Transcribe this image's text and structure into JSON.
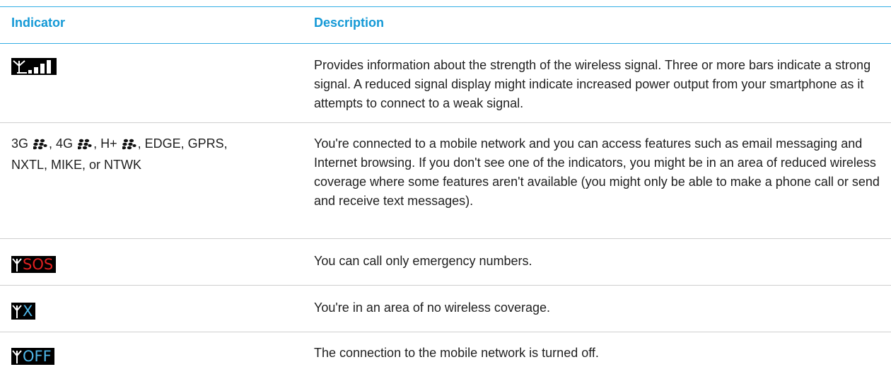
{
  "header": {
    "indicator": "Indicator",
    "description": "Description"
  },
  "rows": [
    {
      "indicator_icon": "signal-strength-icon",
      "description": "Provides information about the strength of the wireless signal. Three or more bars indicate a strong signal. A reduced signal display might indicate increased power output from your smartphone as it attempts to connect to a weak signal."
    },
    {
      "indicator_parts": [
        "3G",
        ", 4G",
        ", H+",
        ", EDGE, GPRS,",
        "NXTL, MIKE, or NTWK"
      ],
      "indicator_icon": "blackberry-logo-icon",
      "description": "You're connected to a mobile network and you can access features such as email messaging and Internet browsing. If you don't see one of the indicators, you might be in an area of reduced wireless coverage where some features aren't available (you might only be able to make a phone call or send and receive text messages)."
    },
    {
      "indicator_icon": "antenna-sos-icon",
      "icon_text": "SOS",
      "icon_text_color": "#e02020",
      "description": "You can call only emergency numbers."
    },
    {
      "indicator_icon": "antenna-x-icon",
      "icon_text": "X",
      "icon_text_color": "#4fb6e8",
      "description": "You're in an area of no wireless coverage."
    },
    {
      "indicator_icon": "antenna-off-icon",
      "icon_text": "OFF",
      "icon_text_color": "#4fb6e8",
      "description": "The connection to the mobile network is turned off."
    }
  ],
  "colors": {
    "header_text": "#1499d6",
    "rule": "#35aee4",
    "icon_bg": "#000000"
  }
}
